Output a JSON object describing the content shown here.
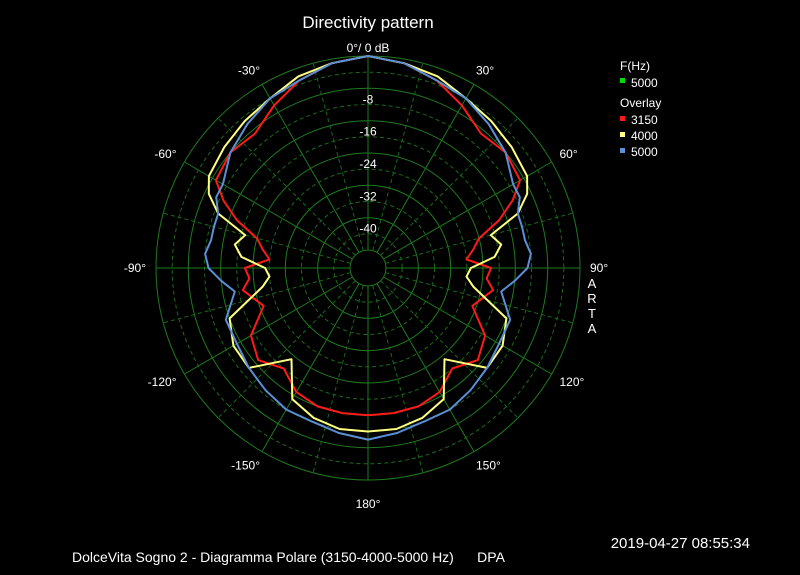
{
  "chart_data": {
    "type": "polar-line",
    "title": "Directivity pattern",
    "center_label": "0°/ 0 dB",
    "radial_range_db": [
      -48,
      0
    ],
    "radial_ticks": [
      {
        "db": -8,
        "label": "-8"
      },
      {
        "db": -16,
        "label": "-16"
      },
      {
        "db": -24,
        "label": "-24"
      },
      {
        "db": -32,
        "label": "-32"
      },
      {
        "db": -40,
        "label": "-40"
      }
    ],
    "angle_labels": [
      {
        "angle": 30,
        "label": "30°"
      },
      {
        "angle": 60,
        "label": "60°"
      },
      {
        "angle": 90,
        "label": "90°"
      },
      {
        "angle": 120,
        "label": "120°"
      },
      {
        "angle": 150,
        "label": "150°"
      },
      {
        "angle": 180,
        "label": "180°"
      },
      {
        "angle": -150,
        "label": "-150°"
      },
      {
        "angle": -120,
        "label": "-120°"
      },
      {
        "angle": -90,
        "label": "-90°"
      },
      {
        "angle": -60,
        "label": "-60°"
      },
      {
        "angle": -30,
        "label": "-30°"
      }
    ],
    "grid": true,
    "legend": {
      "position": "top-right",
      "freq_header": "F(Hz)",
      "current": {
        "label": "5000",
        "color": "#00dd00"
      },
      "overlay_header": "Overlay",
      "overlay": [
        {
          "label": "3150",
          "color": "#ff1a1a"
        },
        {
          "label": "4000",
          "color": "#ffff80"
        },
        {
          "label": "5000",
          "color": "#5b8fd6"
        }
      ]
    },
    "series": [
      {
        "name": "3150",
        "color": "#ff1a1a",
        "angles": [
          0,
          10,
          20,
          30,
          40,
          50,
          60,
          65,
          70,
          75,
          80,
          85,
          90,
          95,
          100,
          110,
          120,
          130,
          140,
          150,
          160,
          170,
          180
        ],
        "values": [
          0,
          -1,
          -3,
          -6,
          -9,
          -8,
          -9,
          -13,
          -18,
          -24,
          -26,
          -28,
          -22,
          -23,
          -21,
          -25,
          -19,
          -17,
          -20,
          -17,
          -16,
          -16,
          -16
        ]
      },
      {
        "name": "4000",
        "color": "#ffff80",
        "angles": [
          0,
          10,
          20,
          30,
          40,
          50,
          60,
          65,
          70,
          75,
          80,
          85,
          90,
          95,
          100,
          110,
          120,
          130,
          140,
          150,
          160,
          170,
          180
        ],
        "values": [
          0,
          -1,
          -2,
          -4,
          -5,
          -6,
          -7,
          -9,
          -13,
          -21,
          -19,
          -21,
          -27,
          -28,
          -26,
          -16,
          -14,
          -14,
          -23,
          -15,
          -13,
          -12,
          -12
        ]
      },
      {
        "name": "5000",
        "color": "#5b8fd6",
        "angles": [
          0,
          10,
          20,
          30,
          40,
          50,
          60,
          65,
          70,
          75,
          80,
          85,
          90,
          95,
          100,
          110,
          120,
          130,
          140,
          150,
          160,
          170,
          180
        ],
        "values": [
          0,
          -1,
          -3,
          -4,
          -6,
          -8,
          -11,
          -11,
          -13,
          -13,
          -13,
          -12,
          -13,
          -16,
          -19,
          -15,
          -15,
          -14,
          -13,
          -12,
          -12,
          -11,
          -10
        ]
      }
    ]
  },
  "side_label": "ARTA",
  "timestamp": "2019-04-27  08:55:34",
  "footer": "DolceVita Sogno 2 - Diagramma Polare (3150-4000-5000 Hz)      DPA"
}
